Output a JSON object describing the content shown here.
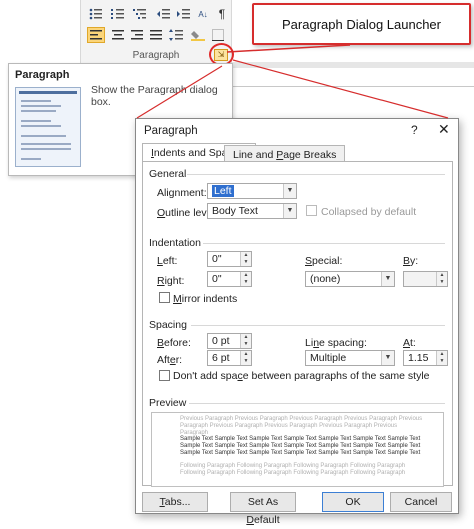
{
  "ribbon": {
    "group_label": "Paragraph",
    "row1_icons": [
      "bullets-icon",
      "numbering-icon",
      "multilevel-list-icon",
      "decrease-indent-icon",
      "increase-indent-icon",
      "sort-icon",
      "show-marks-icon"
    ],
    "row2_icons": [
      "align-left-icon",
      "align-center-icon",
      "align-right-icon",
      "justify-icon",
      "line-spacing-icon",
      "shading-icon",
      "borders-icon"
    ],
    "pilcrow": "¶",
    "sort_glyph": "A↓",
    "launcher_glyph": "⇲"
  },
  "callout": {
    "text": "Paragraph Dialog Launcher",
    "border_color": "#d62d2d"
  },
  "tooltip": {
    "title": "Paragraph",
    "description": "Show the Paragraph dialog box."
  },
  "dialog": {
    "title": "Paragraph",
    "help": "?",
    "close": "✕",
    "tabs": [
      {
        "label_pre": "",
        "label_u": "I",
        "label_post": "ndents and Spacing",
        "active": true
      },
      {
        "label_pre": "Line and ",
        "label_u": "P",
        "label_post": "age Breaks",
        "active": false
      }
    ],
    "general": {
      "heading": "General",
      "alignment_label_pre": "Alignment:",
      "alignment_label_u": "G",
      "alignment_value": "Left",
      "outline_label_u": "O",
      "outline_label_post": "utline level:",
      "outline_value": "Body Text",
      "collapsed_label": "Collapsed by default"
    },
    "indentation": {
      "heading": "Indentation",
      "left_label_u": "L",
      "left_label_post": "eft:",
      "left_value": "0\"",
      "right_label_u": "R",
      "right_label_post": "ight:",
      "right_value": "0\"",
      "special_label_u": "S",
      "special_label_post": "pecial:",
      "special_value": "(none)",
      "by_label_u": "B",
      "by_label_post": "y:",
      "by_value": "",
      "mirror_label_u": "M",
      "mirror_label_post": "irror indents"
    },
    "spacing": {
      "heading": "Spacing",
      "before_label_u": "B",
      "before_label_post": "efore:",
      "before_value": "0 pt",
      "after_label_pre": "Aft",
      "after_label_u": "e",
      "after_label_post": "r:",
      "after_value": "6 pt",
      "line_label_pre": "Li",
      "line_label_u": "n",
      "line_label_post": "e spacing:",
      "line_value": "Multiple",
      "at_label_u": "A",
      "at_label_post": "t:",
      "at_value": "1.15",
      "dont_add_pre": "Don't add spa",
      "dont_add_u": "c",
      "dont_add_post": "e between paragraphs of the same style"
    },
    "preview": {
      "heading": "Preview",
      "previous": "Previous Paragraph Previous Paragraph Previous Paragraph Previous Paragraph Previous Paragraph Previous Paragraph Previous Paragraph Previous Paragraph Previous Paragraph",
      "sample": "Sample Text Sample Text Sample Text Sample Text Sample Text Sample Text Sample Text Sample Text Sample Text Sample Text Sample Text Sample Text Sample Text Sample Text Sample Text Sample Text Sample Text Sample Text Sample Text Sample Text Sample Text",
      "following": "Following Paragraph Following Paragraph Following Paragraph Following Paragraph Following Paragraph Following Paragraph Following Paragraph Following Paragraph"
    },
    "buttons": {
      "tabs_u": "T",
      "tabs_post": "abs...",
      "set_default_pre": "Set As ",
      "set_default_u": "D",
      "set_default_post": "efault",
      "ok": "OK",
      "cancel": "Cancel"
    },
    "dropdown_arrow": "▼",
    "spin_up": "▲",
    "spin_down": "▼"
  }
}
